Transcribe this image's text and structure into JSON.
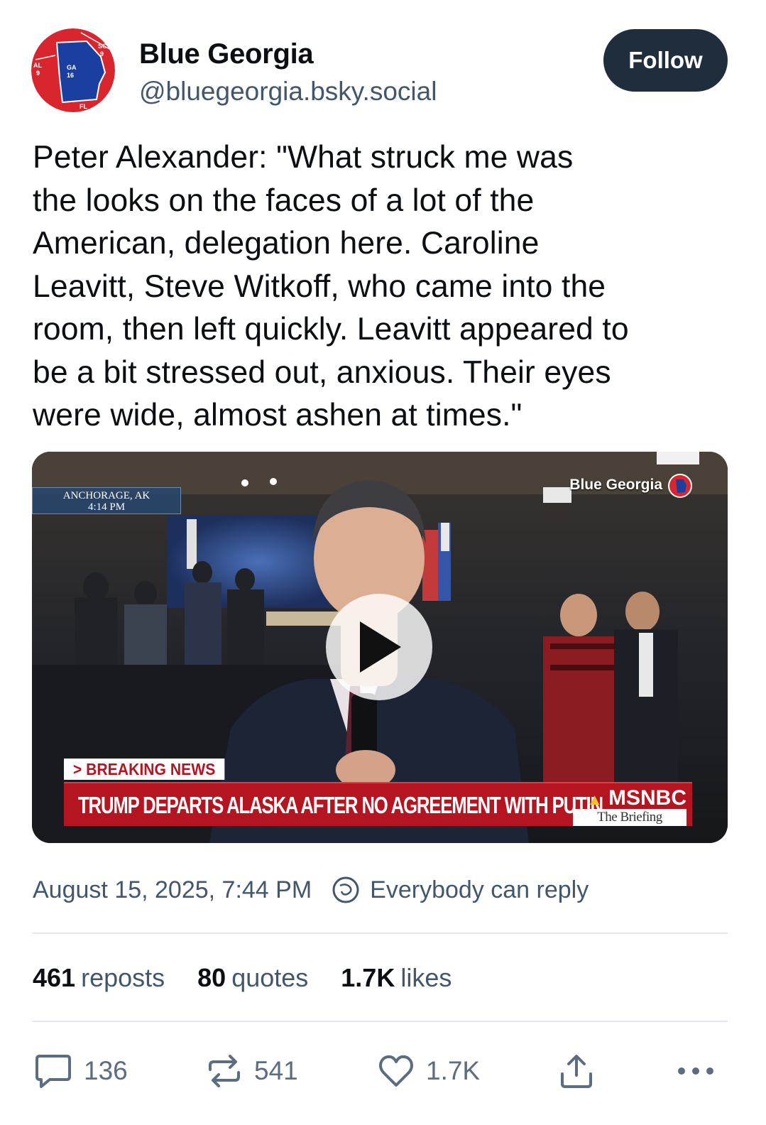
{
  "post": {
    "author": {
      "display_name": "Blue Georgia",
      "handle": "@bluegeorgia.bsky.social",
      "avatar_labels": [
        "SC",
        "9",
        "AL",
        "9",
        "GA",
        "16",
        "FL"
      ]
    },
    "follow_label": "Follow",
    "text": "Peter Alexander: \"What struck me was\nthe looks on the faces of a lot of the\nAmerican, delegation here. Caroline\nLeavitt, Steve Witkoff, who came into the\nroom, then left quickly. Leavitt appeared to\nbe a bit stressed out, anxious. Their eyes\nwere wide, almost ashen at times.\"",
    "video": {
      "location": "ANCHORAGE, AK",
      "time": "4:14 PM",
      "watermark": "Blue Georgia",
      "breaking_tag": "> BREAKING NEWS",
      "headline": "TRUMP DEPARTS ALASKA AFTER NO AGREEMENT WITH PUTIN",
      "network": "MSNBC",
      "show": "The Briefing",
      "play_icon": "play-icon"
    },
    "timestamp": "August 15, 2025, 7:44 PM",
    "reply_setting": "Everybody can reply",
    "stats": {
      "reposts_count": "461",
      "reposts_label": "reposts",
      "quotes_count": "80",
      "quotes_label": "quotes",
      "likes_count": "1.7K",
      "likes_label": "likes"
    },
    "actions": {
      "reply_count": "136",
      "repost_count": "541",
      "like_count": "1.7K",
      "icons": [
        "reply-icon",
        "repost-icon",
        "heart-icon",
        "share-icon",
        "more-icon"
      ]
    }
  },
  "colors": {
    "follow_bg": "#1f2d3d",
    "muted_text": "#42576c",
    "breaking_red": "#b41521",
    "georgia_blue": "#1a3fa0",
    "map_red": "#d9262e"
  }
}
